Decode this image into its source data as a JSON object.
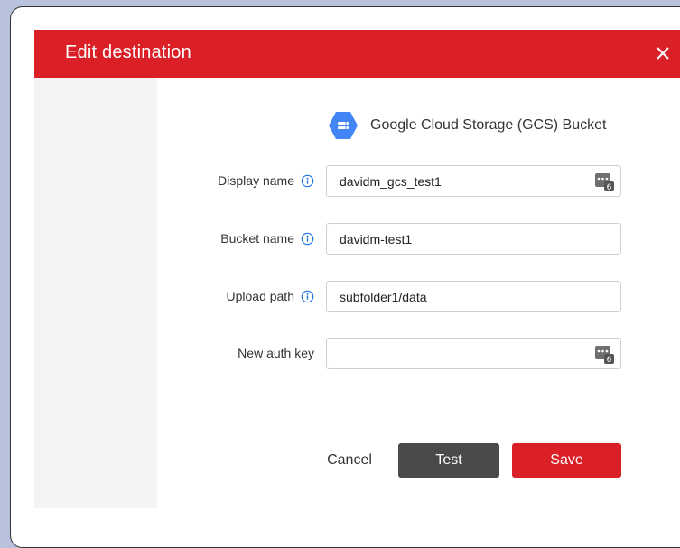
{
  "dialog": {
    "title": "Edit destination"
  },
  "service": {
    "name": "Google Cloud Storage (GCS) Bucket",
    "icon": "gcs-bucket-icon",
    "icon_color": "#4285f4"
  },
  "fields": [
    {
      "label": "Display name",
      "value": "davidm_gcs_test1",
      "has_info": true,
      "has_key_icon": true
    },
    {
      "label": "Bucket name",
      "value": "davidm-test1",
      "has_info": true,
      "has_key_icon": false
    },
    {
      "label": "Upload path",
      "value": "subfolder1/data",
      "has_info": true,
      "has_key_icon": false
    },
    {
      "label": "New auth key",
      "value": "",
      "has_info": false,
      "has_key_icon": true
    }
  ],
  "buttons": {
    "cancel": "Cancel",
    "test": "Test",
    "save": "Save"
  },
  "colors": {
    "header": "#db1f26",
    "save": "#db1f26",
    "test": "#4a4a4a",
    "info": "#1a73e8",
    "sidebar": "#f4f4f4"
  }
}
